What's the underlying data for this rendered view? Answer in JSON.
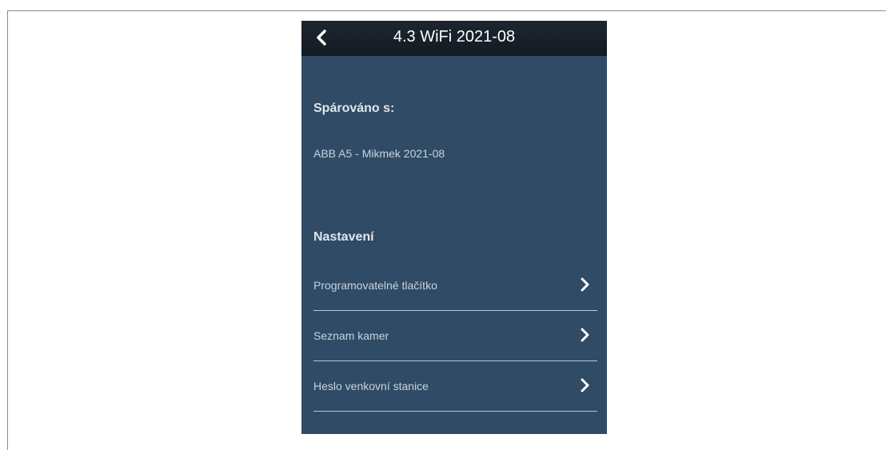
{
  "header": {
    "title": "4.3 WiFi 2021-08",
    "back_icon": "chevron-left-icon"
  },
  "paired": {
    "heading": "Spárováno s:",
    "value": "ABB A5 - Mikmek 2021-08"
  },
  "settings": {
    "heading": "Nastavení",
    "items": [
      {
        "label": "Programovatelné tlačítko",
        "icon": "chevron-right-icon"
      },
      {
        "label": "Seznam kamer",
        "icon": "chevron-right-icon"
      },
      {
        "label": "Heslo venkovní stanice",
        "icon": "chevron-right-icon"
      }
    ]
  },
  "colors": {
    "header_bg": "#161e27",
    "panel_bg": "#2f4b66",
    "text_primary": "#ffffff",
    "text_secondary": "#c8d3de",
    "divider": "#b9c6d3"
  }
}
